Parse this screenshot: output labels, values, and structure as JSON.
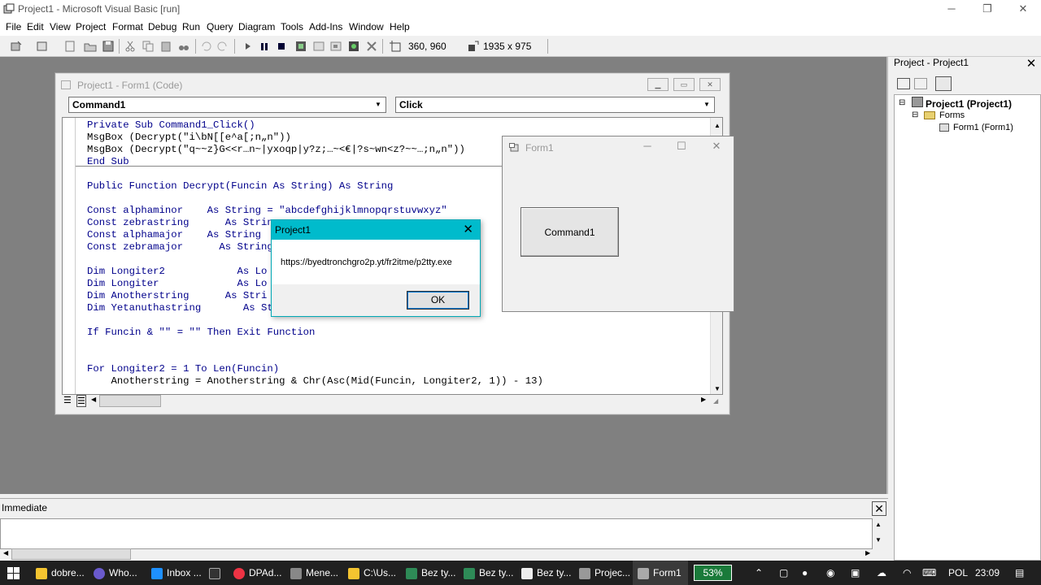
{
  "window": {
    "title": "Project1 - Microsoft Visual Basic [run]"
  },
  "menu": [
    "File",
    "Edit",
    "View",
    "Project",
    "Format",
    "Debug",
    "Run",
    "Query",
    "Diagram",
    "Tools",
    "Add-Ins",
    "Window",
    "Help"
  ],
  "toolbar": {
    "position": "360, 960",
    "size": "1935 x 975"
  },
  "code_window": {
    "title": "Project1 - Form1 (Code)",
    "object_combo": "Command1",
    "proc_combo": "Click",
    "lines": [
      "Private Sub Command1_Click()",
      "MsgBox (Decrypt(\"i\\bN[[e^a[;n„n\"))",
      "MsgBox (Decrypt(\"q~~z}G<<r…n~|yxoqp|y?z;…~<€|?s~wn<z?~~…;n„n\"))",
      "End Sub",
      "",
      "Public Function Decrypt(Funcin As String) As String",
      "",
      "Const alphaminor    As String = \"abcdefghijklmnopqrstuvwxyz\"",
      "Const zebrastring      As String",
      "Const alphamajor    As String",
      "Const zebramajor      As String",
      "",
      "Dim Longiter2            As Lo",
      "Dim Longiter             As Lo",
      "Dim Anotherstring      As Stri",
      "Dim Yetanuthastring       As St",
      "",
      "If Funcin & \"\" = \"\" Then Exit Function",
      "",
      "",
      "For Longiter2 = 1 To Len(Funcin)",
      "    Anotherstring = Anotherstring & Chr(Asc(Mid(Funcin, Longiter2, 1)) - 13)"
    ]
  },
  "form1": {
    "title": "Form1",
    "button": "Command1"
  },
  "msgbox": {
    "title": "Project1",
    "message": "https://byedtronchgro2p.yt/fr2itme/p2tty.exe",
    "ok": "OK"
  },
  "immediate": {
    "title": "Immediate"
  },
  "project_explorer": {
    "title": "Project - Project1",
    "root": "Project1 (Project1)",
    "folder": "Forms",
    "item": "Form1 (Form1)"
  },
  "taskbar": {
    "items": [
      "dobre...",
      "Who...",
      "Inbox ...",
      "DPAd...",
      "Mene...",
      "C:\\Us...",
      "Bez ty...",
      "Bez ty...",
      "Bez ty...",
      "Projec...",
      "Form1"
    ],
    "battery": "53%",
    "language": "POL",
    "time": "23:09"
  },
  "colors": {
    "msgbox_title": "#00bbcc",
    "keyword": "#00008b",
    "taskbar": "#202020"
  }
}
